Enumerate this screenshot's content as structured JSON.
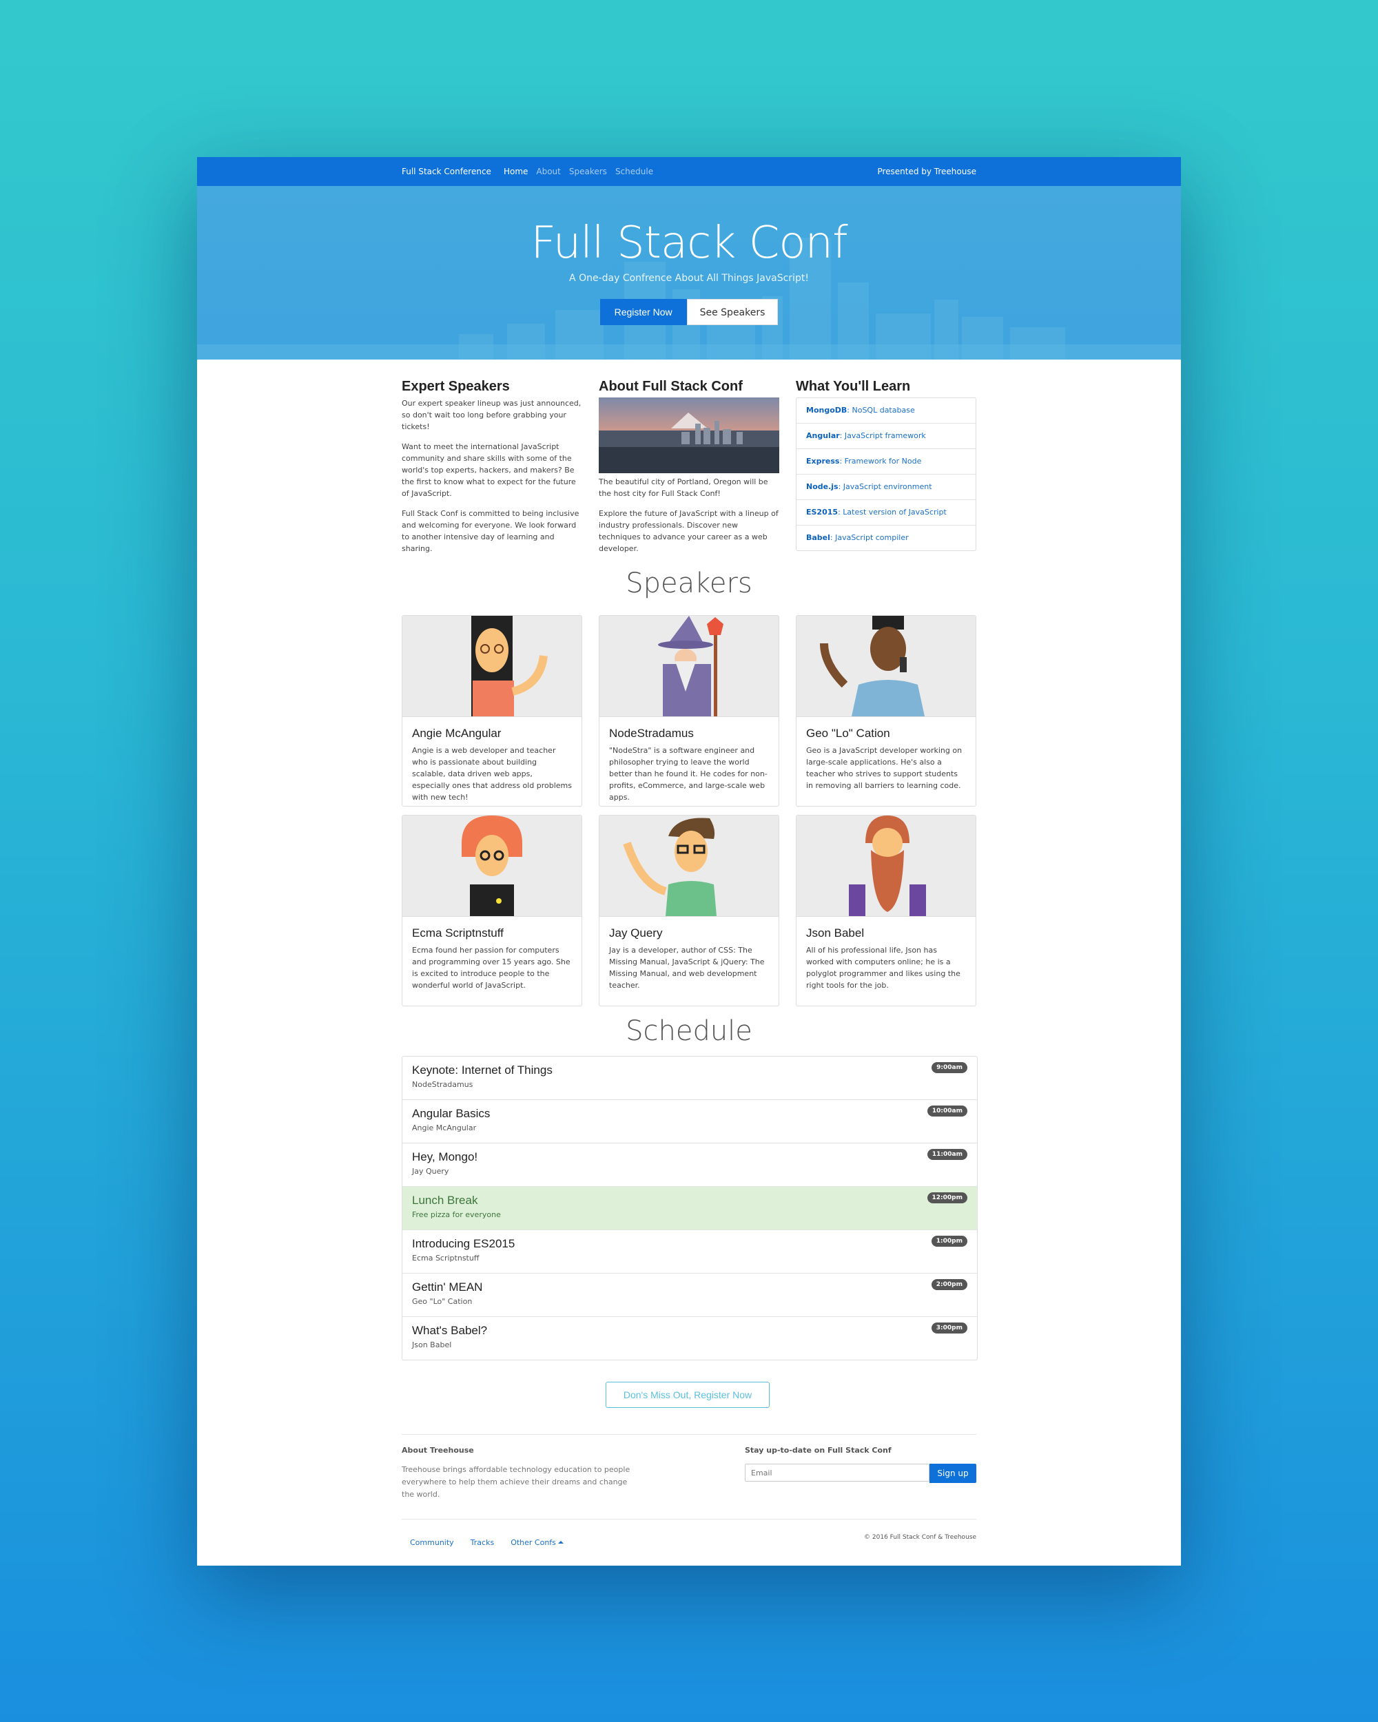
{
  "navbar": {
    "brand": "Full Stack Conference",
    "links": [
      "Home",
      "About",
      "Speakers",
      "Schedule"
    ],
    "presented": "Presented by Treehouse"
  },
  "hero": {
    "title": "Full Stack Conf",
    "subtitle": "A One-day Confrence About All Things JavaScript!",
    "register_button": "Register Now",
    "speakers_button": "See Speakers"
  },
  "columns": {
    "expert": {
      "heading": "Expert Speakers",
      "paragraphs": [
        "Our expert speaker lineup was just announced, so don't wait too long before grabbing your tickets!",
        "Want to meet the international JavaScript community and share skills with some of the world's top experts, hackers, and makers? Be the first to know what to expect for the future of JavaScript.",
        "Full Stack Conf is committed to being inclusive and welcoming for everyone. We look forward to another intensive day of learning and sharing."
      ]
    },
    "about": {
      "heading": "About Full Stack Conf",
      "paragraphs": [
        "The beautiful city of Portland, Oregon will be the host city for Full Stack Conf!",
        "Explore the future of JavaScript with a lineup of industry professionals. Discover new techniques to advance your career as a web developer."
      ]
    },
    "learn": {
      "heading": "What You'll Learn",
      "items": [
        {
          "name": "MongoDB",
          "desc": ": NoSQL database"
        },
        {
          "name": "Angular",
          "desc": ": JavaScript framework"
        },
        {
          "name": "Express",
          "desc": ": Framework for Node"
        },
        {
          "name": "Node.js",
          "desc": ": JavaScript environment"
        },
        {
          "name": "ES2015",
          "desc": ": Latest version of JavaScript"
        },
        {
          "name": "Babel",
          "desc": ": JavaScript compiler"
        }
      ]
    }
  },
  "speakers": {
    "title": "Speakers",
    "list": [
      {
        "name": "Angie McAngular",
        "bio": "Angie is a web developer and teacher who is passionate about building scalable, data driven web apps, especially ones that address old problems with new tech!"
      },
      {
        "name": "NodeStradamus",
        "bio": "\"NodeStra\" is a software engineer and philosopher trying to leave the world better than he found it. He codes for non-profits, eCommerce, and large-scale web apps."
      },
      {
        "name": "Geo \"Lo\" Cation",
        "bio": "Geo is a JavaScript developer working on large-scale applications. He's also a teacher who strives to support students in removing all barriers to learning code."
      },
      {
        "name": "Ecma Scriptnstuff",
        "bio": "Ecma found her passion for computers and programming over 15 years ago. She is excited to introduce people to the wonderful world of JavaScript."
      },
      {
        "name": "Jay Query",
        "bio": "Jay is a developer, author of CSS: The Missing Manual, JavaScript & jQuery: The Missing Manual, and web development teacher."
      },
      {
        "name": "Json Babel",
        "bio": "All of his professional life, Json has worked with computers online; he is a polyglot programmer and likes using the right tools for the job."
      }
    ]
  },
  "schedule": {
    "title": "Schedule",
    "items": [
      {
        "title": "Keynote: Internet of Things",
        "speaker": "NodeStradamus",
        "time": "9:00am"
      },
      {
        "title": "Angular Basics",
        "speaker": "Angie McAngular",
        "time": "10:00am"
      },
      {
        "title": "Hey, Mongo!",
        "speaker": "Jay Query",
        "time": "11:00am"
      },
      {
        "title": "Lunch Break",
        "speaker": "Free pizza for everyone",
        "time": "12:00pm"
      },
      {
        "title": "Introducing ES2015",
        "speaker": "Ecma Scriptnstuff",
        "time": "1:00pm"
      },
      {
        "title": "Gettin' MEAN",
        "speaker": "Geo \"Lo\" Cation",
        "time": "2:00pm"
      },
      {
        "title": "What's Babel?",
        "speaker": "Json Babel",
        "time": "3:00pm"
      }
    ]
  },
  "cta": "Don's Miss Out, Register Now",
  "footer": {
    "about_heading": "About Treehouse",
    "about_text": "Treehouse brings affordable technology education to people everywhere to help them achieve their dreams and change the world.",
    "stay_heading": "Stay up-to-date on Full Stack Conf",
    "email_placeholder": "Email",
    "signup": "Sign up",
    "links": [
      "Community",
      "Tracks",
      "Other Confs"
    ],
    "copyright": "© 2016 Full Stack Conf & Treehouse"
  },
  "colors": {
    "primary": "#0d71d9",
    "hero": "#44a9de",
    "lunch_bg": "#dff0d8",
    "cta": "#5bc0de"
  }
}
